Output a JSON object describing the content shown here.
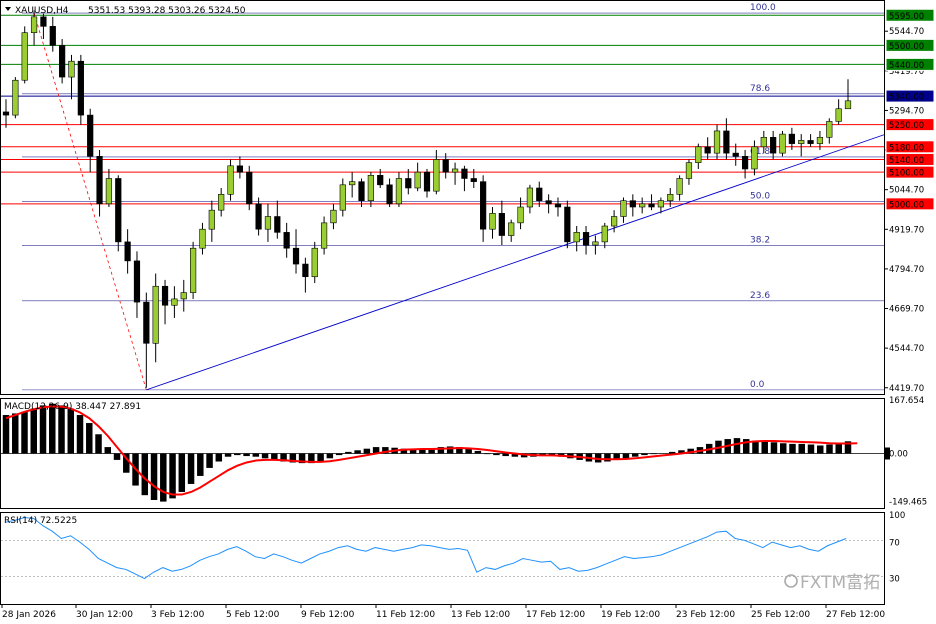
{
  "header": {
    "symbol": "XAUUSD,H4",
    "ohlc": "5351.53 5393.28 5303.26 5324.50"
  },
  "colors": {
    "bull": "#9acd32",
    "bear": "#000000",
    "green_line": "#008000",
    "red_line": "#ff0000",
    "blue_line": "#00008b",
    "fib": "#333399",
    "trend": "#0000cd",
    "macd_signal": "#ff0000",
    "rsi": "#1e90ff"
  },
  "watermark": "FXTM富拓",
  "chart_data": [
    {
      "type": "candlestick",
      "title": "XAUUSD,H4",
      "ylim": [
        4400,
        5640
      ],
      "yticks": [
        "5544.70",
        "5419.70",
        "5294.70",
        "5169.70",
        "5044.70",
        "4919.70",
        "4794.70",
        "4669.70",
        "4544.70",
        "4419.70"
      ],
      "xticks": [
        "28 Jan 2026",
        "30 Jan 12:00",
        "3 Feb 12:00",
        "5 Feb 12:00",
        "9 Feb 12:00",
        "11 Feb 12:00",
        "13 Feb 12:00",
        "17 Feb 12:00",
        "19 Feb 12:00",
        "23 Feb 12:00",
        "25 Feb 12:00",
        "27 Feb 12:00"
      ],
      "levels": [
        {
          "label": "5595.00",
          "value": 5595,
          "color": "#008000"
        },
        {
          "label": "5500.00",
          "value": 5500,
          "color": "#008000"
        },
        {
          "label": "5440.00",
          "value": 5440,
          "color": "#008000"
        },
        {
          "label": "5340.00",
          "value": 5340,
          "color": "#00008b"
        },
        {
          "label": "5250.00",
          "value": 5250,
          "color": "#ff0000"
        },
        {
          "label": "5180.00",
          "value": 5180,
          "color": "#ff0000"
        },
        {
          "label": "5140.00",
          "value": 5140,
          "color": "#ff0000"
        },
        {
          "label": "5100.00",
          "value": 5100,
          "color": "#ff0000"
        },
        {
          "label": "5000.00",
          "value": 5000,
          "color": "#ff0000"
        }
      ],
      "fibonacci": [
        {
          "label": "100.0",
          "value": 5602
        },
        {
          "label": "78.6",
          "value": 5347
        },
        {
          "label": "61.8",
          "value": 5148
        },
        {
          "label": "50.0",
          "value": 5008
        },
        {
          "label": "38.2",
          "value": 4868
        },
        {
          "label": "23.6",
          "value": 4694
        },
        {
          "label": "0.0",
          "value": 4413
        }
      ],
      "trendline": [
        [
          0,
          4413
        ],
        [
          120,
          5218
        ]
      ],
      "candles": [
        [
          5290,
          5330,
          5240,
          5280
        ],
        [
          5280,
          5400,
          5270,
          5390
        ],
        [
          5390,
          5560,
          5380,
          5540
        ],
        [
          5540,
          5610,
          5500,
          5590
        ],
        [
          5590,
          5600,
          5520,
          5560
        ],
        [
          5560,
          5590,
          5480,
          5500
        ],
        [
          5500,
          5520,
          5380,
          5400
        ],
        [
          5400,
          5470,
          5330,
          5450
        ],
        [
          5450,
          5470,
          5250,
          5280
        ],
        [
          5280,
          5300,
          5100,
          5150
        ],
        [
          5150,
          5170,
          4960,
          5000
        ],
        [
          5000,
          5110,
          4990,
          5080
        ],
        [
          5080,
          5090,
          4850,
          4880
        ],
        [
          4880,
          4920,
          4780,
          4820
        ],
        [
          4820,
          4850,
          4640,
          4690
        ],
        [
          4690,
          4720,
          4420,
          4560
        ],
        [
          4560,
          4780,
          4500,
          4740
        ],
        [
          4740,
          4760,
          4620,
          4680
        ],
        [
          4680,
          4740,
          4640,
          4700
        ],
        [
          4700,
          4760,
          4660,
          4720
        ],
        [
          4720,
          4880,
          4700,
          4860
        ],
        [
          4860,
          4940,
          4840,
          4920
        ],
        [
          4920,
          5010,
          4880,
          4980
        ],
        [
          4980,
          5050,
          4960,
          5030
        ],
        [
          5030,
          5140,
          5010,
          5120
        ],
        [
          5120,
          5150,
          5080,
          5100
        ],
        [
          5100,
          5120,
          4980,
          5000
        ],
        [
          5000,
          5020,
          4900,
          4920
        ],
        [
          4920,
          5000,
          4880,
          4960
        ],
        [
          4960,
          5010,
          4890,
          4910
        ],
        [
          4910,
          4940,
          4830,
          4860
        ],
        [
          4860,
          4920,
          4780,
          4810
        ],
        [
          4810,
          4830,
          4720,
          4770
        ],
        [
          4770,
          4880,
          4750,
          4860
        ],
        [
          4860,
          4960,
          4840,
          4940
        ],
        [
          4940,
          5000,
          4920,
          4980
        ],
        [
          4980,
          5080,
          4960,
          5060
        ],
        [
          5060,
          5100,
          5020,
          5070
        ],
        [
          5070,
          5080,
          4990,
          5010
        ],
        [
          5010,
          5100,
          4990,
          5090
        ],
        [
          5090,
          5110,
          5050,
          5060
        ],
        [
          5060,
          5080,
          4990,
          5000
        ],
        [
          5000,
          5100,
          4990,
          5080
        ],
        [
          5080,
          5110,
          5030,
          5050
        ],
        [
          5050,
          5130,
          5040,
          5100
        ],
        [
          5100,
          5110,
          5020,
          5040
        ],
        [
          5040,
          5170,
          5030,
          5140
        ],
        [
          5140,
          5160,
          5080,
          5100
        ],
        [
          5100,
          5130,
          5060,
          5110
        ],
        [
          5110,
          5120,
          5040,
          5080
        ],
        [
          5080,
          5110,
          5050,
          5070
        ],
        [
          5070,
          5090,
          4880,
          4920
        ],
        [
          4920,
          4990,
          4890,
          4970
        ],
        [
          4970,
          5010,
          4870,
          4900
        ],
        [
          4900,
          4950,
          4880,
          4940
        ],
        [
          4940,
          5020,
          4920,
          4990
        ],
        [
          4990,
          5060,
          4970,
          5050
        ],
        [
          5050,
          5070,
          4990,
          5010
        ],
        [
          5010,
          5030,
          4970,
          5000
        ],
        [
          5000,
          5020,
          4960,
          4990
        ],
        [
          4990,
          5010,
          4860,
          4880
        ],
        [
          4880,
          4930,
          4850,
          4910
        ],
        [
          4910,
          4930,
          4840,
          4870
        ],
        [
          4870,
          4900,
          4840,
          4880
        ],
        [
          4880,
          4940,
          4860,
          4930
        ],
        [
          4930,
          4980,
          4910,
          4960
        ],
        [
          4960,
          5020,
          4940,
          5010
        ],
        [
          5010,
          5030,
          4960,
          4990
        ],
        [
          4990,
          5020,
          4970,
          5000
        ],
        [
          5000,
          5030,
          4980,
          4990
        ],
        [
          4990,
          5020,
          4970,
          5010
        ],
        [
          5010,
          5050,
          4990,
          5030
        ],
        [
          5030,
          5090,
          5010,
          5080
        ],
        [
          5080,
          5140,
          5060,
          5130
        ],
        [
          5130,
          5190,
          5110,
          5180
        ],
        [
          5180,
          5210,
          5140,
          5160
        ],
        [
          5160,
          5250,
          5140,
          5230
        ],
        [
          5230,
          5270,
          5140,
          5160
        ],
        [
          5160,
          5190,
          5120,
          5150
        ],
        [
          5150,
          5170,
          5080,
          5110
        ],
        [
          5110,
          5200,
          5090,
          5180
        ],
        [
          5180,
          5230,
          5160,
          5210
        ],
        [
          5210,
          5230,
          5140,
          5160
        ],
        [
          5160,
          5230,
          5150,
          5220
        ],
        [
          5220,
          5240,
          5170,
          5190
        ],
        [
          5190,
          5220,
          5150,
          5200
        ],
        [
          5200,
          5220,
          5180,
          5190
        ],
        [
          5190,
          5230,
          5170,
          5210
        ],
        [
          5210,
          5270,
          5190,
          5260
        ],
        [
          5260,
          5330,
          5250,
          5300
        ],
        [
          5300,
          5393,
          5303,
          5325
        ]
      ]
    },
    {
      "type": "bar",
      "title": "MACD(12,26,9) 38.447 27.891",
      "ylim": [
        -170,
        170
      ],
      "yticks": [
        "167.654",
        "0.00",
        "-149.465"
      ],
      "values": [
        120,
        125,
        130,
        140,
        150,
        155,
        150,
        140,
        120,
        95,
        60,
        20,
        -20,
        -60,
        -100,
        -130,
        -145,
        -150,
        -140,
        -120,
        -95,
        -70,
        -45,
        -25,
        -10,
        -5,
        -8,
        -10,
        -15,
        -20,
        -25,
        -28,
        -30,
        -30,
        -25,
        -15,
        -5,
        5,
        10,
        15,
        20,
        20,
        18,
        15,
        14,
        12,
        15,
        20,
        22,
        20,
        15,
        8,
        -2,
        -5,
        -8,
        -10,
        -12,
        -10,
        -8,
        -5,
        -10,
        -15,
        -20,
        -25,
        -28,
        -25,
        -20,
        -15,
        -10,
        -5,
        -2,
        0,
        5,
        10,
        15,
        20,
        30,
        40,
        45,
        48,
        45,
        40,
        38,
        35,
        32,
        30,
        30,
        28,
        25,
        28,
        32,
        38
      ],
      "signal": [
        110,
        120,
        130,
        138,
        144,
        147,
        146,
        140,
        128,
        110,
        85,
        55,
        20,
        -15,
        -48,
        -78,
        -102,
        -120,
        -128,
        -128,
        -120,
        -106,
        -88,
        -70,
        -52,
        -38,
        -28,
        -22,
        -20,
        -20,
        -21,
        -23,
        -25,
        -26,
        -26,
        -24,
        -20,
        -15,
        -10,
        -5,
        0,
        5,
        9,
        12,
        13,
        14,
        14,
        15,
        16,
        17,
        16,
        14,
        11,
        7,
        3,
        0,
        -3,
        -5,
        -6,
        -6,
        -7,
        -9,
        -11,
        -14,
        -17,
        -18,
        -18,
        -17,
        -15,
        -12,
        -9,
        -6,
        -3,
        0,
        4,
        8,
        13,
        18,
        24,
        30,
        35,
        38,
        39,
        39,
        38,
        37,
        36,
        35,
        34,
        32,
        31,
        31,
        32
      ]
    },
    {
      "type": "line",
      "title": "RSI(14) 72.5225",
      "ylim": [
        0,
        100
      ],
      "yticks": [
        "100",
        "70",
        "30"
      ],
      "values": [
        90,
        92,
        95,
        94,
        86,
        80,
        72,
        75,
        68,
        60,
        50,
        45,
        40,
        38,
        33,
        28,
        35,
        40,
        36,
        38,
        42,
        48,
        52,
        55,
        60,
        63,
        58,
        52,
        50,
        55,
        52,
        48,
        45,
        50,
        55,
        58,
        62,
        64,
        60,
        58,
        62,
        60,
        58,
        60,
        62,
        65,
        64,
        62,
        60,
        61,
        59,
        35,
        40,
        38,
        42,
        45,
        50,
        48,
        46,
        47,
        38,
        40,
        36,
        37,
        40,
        44,
        48,
        52,
        50,
        51,
        52,
        54,
        58,
        62,
        66,
        70,
        74,
        79,
        80,
        72,
        70,
        66,
        62,
        68,
        65,
        62,
        64,
        60,
        58,
        64,
        68,
        72
      ]
    }
  ]
}
